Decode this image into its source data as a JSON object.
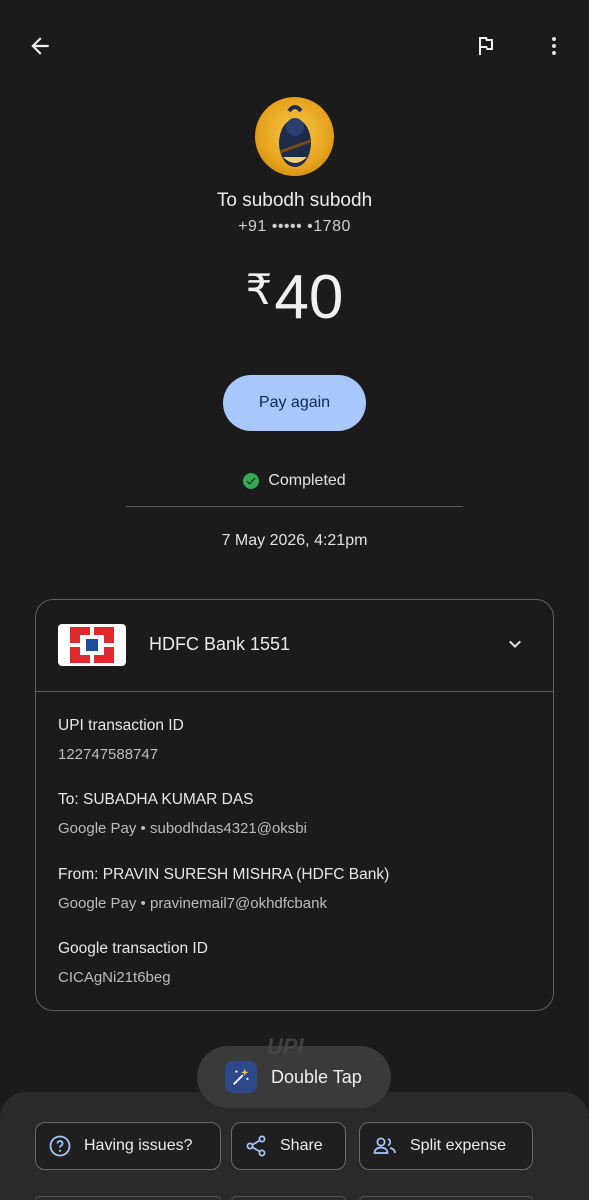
{
  "header": {
    "back_icon": "arrow-left-icon",
    "flag_icon": "flag-icon",
    "more_icon": "more-vertical-icon"
  },
  "payee": {
    "title": "To subodh subodh",
    "phone": "+91 ••••• •1780"
  },
  "amount": {
    "currency": "₹",
    "value": "40"
  },
  "pay_again_label": "Pay again",
  "status": {
    "label": "Completed",
    "color": "#34a853"
  },
  "datetime": "7 May 2026, 4:21pm",
  "bank": {
    "name": "HDFC Bank 1551"
  },
  "details": [
    {
      "label": "UPI transaction ID",
      "value": "122747588747"
    },
    {
      "label": "To: SUBADHA KUMAR DAS",
      "value": "Google Pay • subodhdas4321@oksbi"
    },
    {
      "label": "From: PRAVIN SURESH MISHRA (HDFC Bank)",
      "value": "Google Pay • pravinemail7@okhdfcbank"
    },
    {
      "label": "Google transaction ID",
      "value": "CICAgNi21t6beg"
    }
  ],
  "toast": {
    "label": "Double Tap",
    "watermark": "UPI"
  },
  "actions": {
    "issues": "Having issues?",
    "share": "Share",
    "split": "Split expense"
  },
  "colors": {
    "background": "#1b1b1b",
    "accent": "#a8c7fa"
  }
}
